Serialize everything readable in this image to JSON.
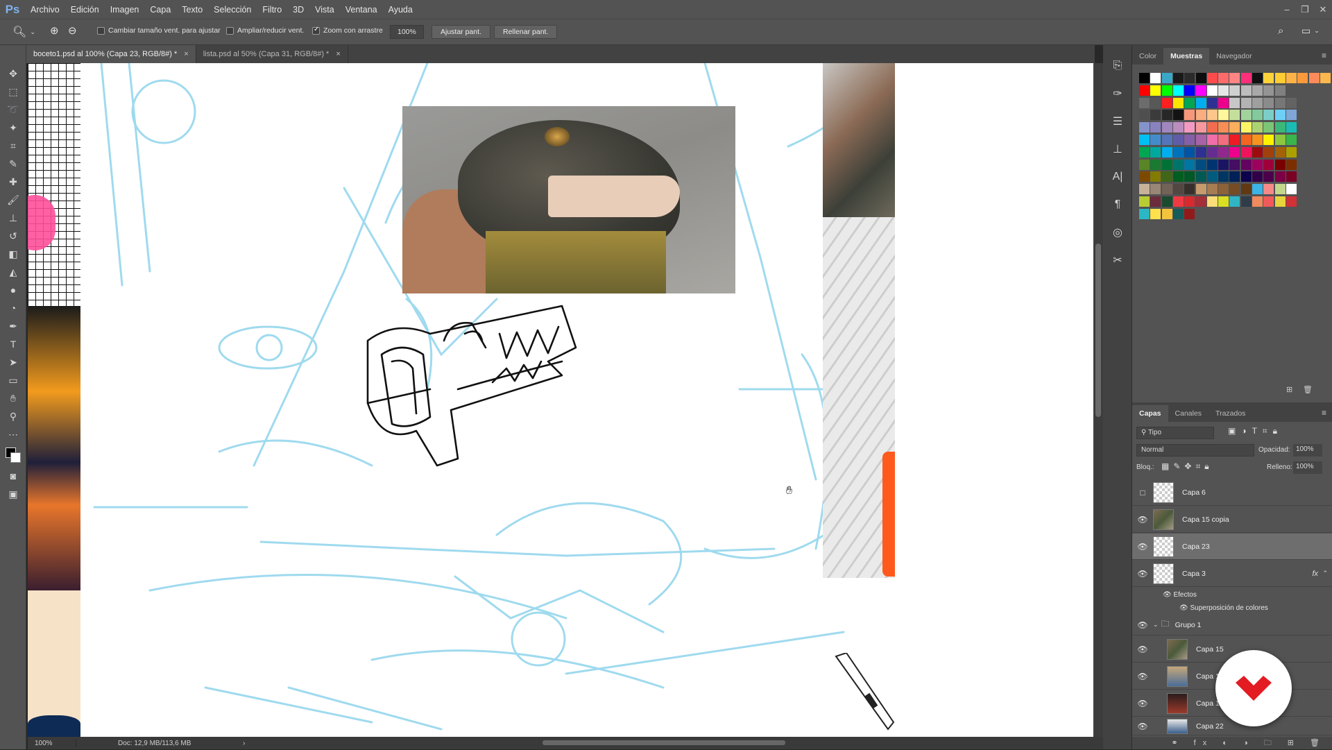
{
  "app": {
    "logo": "Ps"
  },
  "menu": [
    "Archivo",
    "Edición",
    "Imagen",
    "Capa",
    "Texto",
    "Selección",
    "Filtro",
    "3D",
    "Vista",
    "Ventana",
    "Ayuda"
  ],
  "window_controls": [
    "minimize-icon",
    "restore-icon",
    "close-icon"
  ],
  "options": {
    "resize_windows_label": "Cambiar tamaño vent. para ajustar",
    "resize_windows_checked": false,
    "zoom_all_label": "Ampliar/reducir vent.",
    "zoom_all_checked": false,
    "scrubby_label": "Zoom con arrastre",
    "scrubby_checked": true,
    "zoom_value": "100%",
    "fit_screen": "Ajustar pant.",
    "fill_screen": "Rellenar pant."
  },
  "tabs": [
    {
      "label": "boceto1.psd al 100% (Capa 23, RGB/8#) *",
      "active": true
    },
    {
      "label": "lista.psd al 50% (Capa 31, RGB/8#) *",
      "active": false
    }
  ],
  "status": {
    "zoom": "100%",
    "doc": "Doc: 12,9 MB/113,6 MB"
  },
  "swatch_panel": {
    "tabs": [
      "Color",
      "Muestras",
      "Navegador"
    ],
    "active": "Muestras"
  },
  "layers_panel": {
    "tabs": [
      "Capas",
      "Canales",
      "Trazados"
    ],
    "active": "Capas",
    "filter": "Tipo",
    "blend_mode": "Normal",
    "opacity_label": "Opacidad:",
    "opacity": "100%",
    "lock_label": "Bloq.:",
    "fill_label": "Relleno:",
    "fill": "100%",
    "layers": [
      {
        "name": "Capa 6",
        "visible": false,
        "photo": false,
        "selected": false
      },
      {
        "name": "Capa 15 copia",
        "visible": true,
        "photo": true,
        "selected": false
      },
      {
        "name": "Capa 23",
        "visible": true,
        "photo": false,
        "selected": true
      },
      {
        "name": "Capa 3",
        "visible": true,
        "photo": false,
        "selected": false,
        "fx": "fx"
      }
    ],
    "effects_label": "Efectos",
    "effect_item": "Superposición de colores",
    "group": "Grupo 1",
    "group_layers": [
      {
        "name": "Capa 15"
      },
      {
        "name": "Capa 18"
      },
      {
        "name": "Capa 1"
      },
      {
        "name": "Capa 22"
      }
    ]
  },
  "colors": {
    "accent": "#e31b23",
    "sketch_blue": "#7fd0ea",
    "panel": "#535353"
  }
}
